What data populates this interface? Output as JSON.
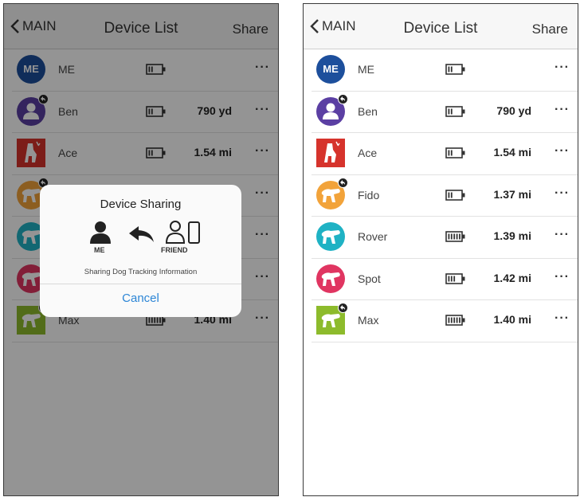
{
  "nav": {
    "back_label": "MAIN",
    "title": "Device List",
    "share_label": "Share"
  },
  "devices": [
    {
      "name": "ME",
      "avatar_text": "ME",
      "avatar_color": "#1d4f9c",
      "shape": "circle",
      "battery_level": 0.4,
      "distance": "",
      "shared": false
    },
    {
      "name": "Ben",
      "avatar_text": "",
      "avatar_color": "#5b3fa3",
      "shape": "circle",
      "battery_level": 0.4,
      "distance": "790 yd",
      "shared": true
    },
    {
      "name": "Ace",
      "avatar_text": "",
      "avatar_color": "#d6332c",
      "shape": "square",
      "battery_level": 0.4,
      "distance": "1.54 mi",
      "shared": false
    },
    {
      "name": "Fido",
      "avatar_text": "",
      "avatar_color": "#f2a33a",
      "shape": "circle",
      "battery_level": 0.4,
      "distance": "1.37 mi",
      "shared": true
    },
    {
      "name": "Rover",
      "avatar_text": "",
      "avatar_color": "#1fb2c4",
      "shape": "circle",
      "battery_level": 1.0,
      "distance": "1.39 mi",
      "shared": false
    },
    {
      "name": "Spot",
      "avatar_text": "",
      "avatar_color": "#e03561",
      "shape": "circle",
      "battery_level": 0.6,
      "distance": "1.42 mi",
      "shared": false
    },
    {
      "name": "Max",
      "avatar_text": "",
      "avatar_color": "#8dbb2c",
      "shape": "square",
      "battery_level": 1.0,
      "distance": "1.40 mi",
      "shared": true
    }
  ],
  "more_label": "···",
  "dialog": {
    "title": "Device Sharing",
    "me_label": "ME",
    "friend_label": "FRIEND",
    "description": "Sharing Dog Tracking Information",
    "cancel_label": "Cancel"
  },
  "colors": {
    "accent": "#2d86d6",
    "overlay": "rgba(0,0,0,0.42)"
  },
  "icons": {
    "back": "chevron-left-icon",
    "battery": "battery-icon",
    "person": "person-icon",
    "share_arrow": "share-arrow-icon",
    "friend_device": "friend-device-icon"
  }
}
